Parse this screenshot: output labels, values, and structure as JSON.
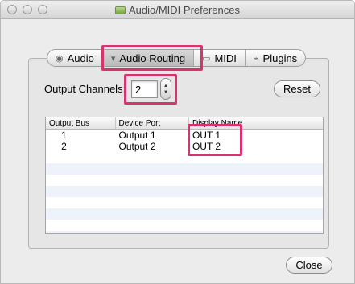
{
  "window": {
    "title": "Audio/MIDI Preferences"
  },
  "tabs": [
    {
      "label": "Audio",
      "icon": "speaker-icon"
    },
    {
      "label": "Audio Routing",
      "icon": "routing-icon"
    },
    {
      "label": "MIDI",
      "icon": "midi-icon"
    },
    {
      "label": "Plugins",
      "icon": "plugin-icon"
    }
  ],
  "selected_tab": "Audio Routing",
  "output_channels": {
    "label": "Output Channels:",
    "value": "2"
  },
  "buttons": {
    "reset": "Reset",
    "close": "Close"
  },
  "table": {
    "headers": [
      "Output Bus",
      "Device Port",
      "Display Name"
    ],
    "rows": [
      {
        "bus": "1",
        "port": "Output 1",
        "name": "OUT 1"
      },
      {
        "bus": "2",
        "port": "Output 2",
        "name": "OUT 2"
      }
    ]
  },
  "colors": {
    "highlight": "#d8336f",
    "window_bg": "#ececec",
    "row_stripe": "#eef3fb"
  }
}
